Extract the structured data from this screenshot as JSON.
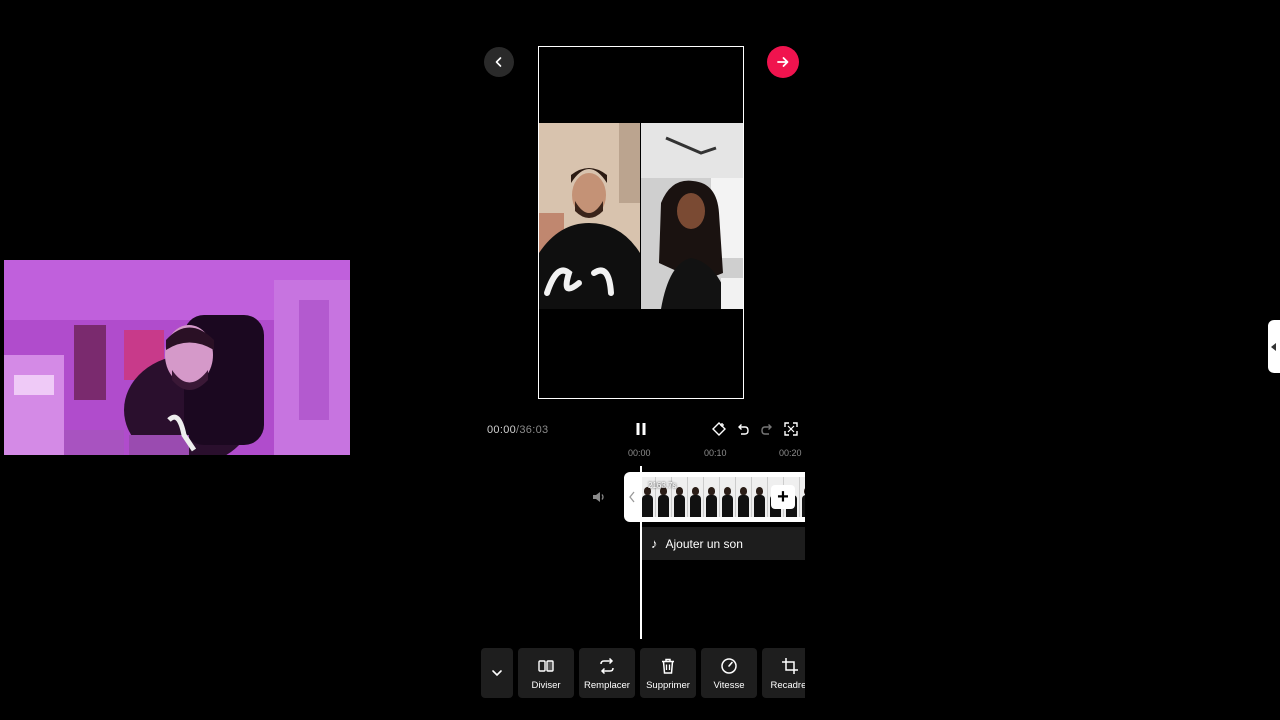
{
  "colors": {
    "accent": "#f0134e",
    "background": "#000000",
    "panel": "#1e1e1e"
  },
  "nav": {
    "back_icon": "chevron-left-icon",
    "next_icon": "arrow-right-icon"
  },
  "player": {
    "current_time": "00:00",
    "total_time": "/36:03"
  },
  "ruler": {
    "ticks": [
      "00:00",
      "00:10",
      "00:20"
    ]
  },
  "timeline": {
    "clip_duration": "2163.7s",
    "add_sound_label": "Ajouter un son"
  },
  "toolbar": {
    "tools": [
      {
        "label": "Diviser",
        "icon": "split-icon"
      },
      {
        "label": "Remplacer",
        "icon": "replace-icon"
      },
      {
        "label": "Supprimer",
        "icon": "trash-icon"
      },
      {
        "label": "Vitesse",
        "icon": "speed-icon"
      },
      {
        "label": "Recadrer",
        "icon": "crop-icon"
      }
    ]
  }
}
